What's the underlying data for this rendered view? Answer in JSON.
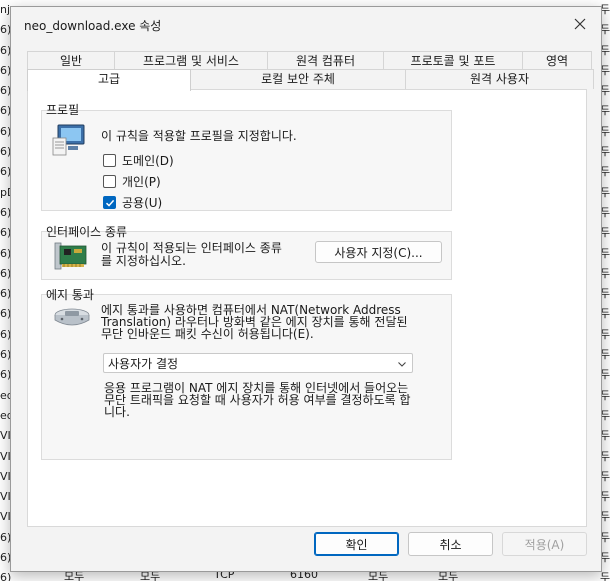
{
  "background": {
    "left_column": [
      "nj",
      "6)",
      "6)",
      "6)",
      "6)",
      "6)",
      "6)",
      "6)",
      "6)",
      "pD",
      "6)",
      "6)",
      "6)",
      "6)",
      "6)",
      "6)",
      "6)",
      "6)",
      "6)",
      "ed",
      "ed",
      "VID",
      "VID",
      "VID",
      "VID",
      "VID",
      "6)",
      "6)#C",
      "6)"
    ],
    "right_column": [
      "두",
      "두",
      "두",
      "두",
      "두",
      "두",
      "두",
      "두",
      "두",
      "두",
      "두",
      "두",
      "두",
      "두",
      "두",
      "두",
      "두",
      "두",
      "두",
      "두",
      "두",
      "두",
      "두",
      "두",
      "두",
      "두",
      "두",
      "두",
      "두"
    ],
    "bottom_row": [
      "모두",
      "모두",
      "TCP",
      "6160",
      "모두",
      "모두"
    ]
  },
  "dialog": {
    "title": "neo_download.exe 속성",
    "close_symbol": "✕"
  },
  "tabs": {
    "row1": [
      "일반",
      "프로그램 및 서비스",
      "원격 컴퓨터",
      "프로토콜 및 포트",
      "영역"
    ],
    "row2": [
      "고급",
      "로컬 보안 주체",
      "원격 사용자"
    ],
    "active": "고급"
  },
  "profiles": {
    "label": "프로필",
    "description": "이 규칙을 적용할 프로필을 지정합니다.",
    "options": [
      {
        "label": "도메인(D)",
        "checked": false
      },
      {
        "label": "개인(P)",
        "checked": false
      },
      {
        "label": "공용(U)",
        "checked": true
      }
    ]
  },
  "interface_types": {
    "label": "인터페이스 종류",
    "description_line1": "이 규칙이 적용되는 인터페이스 종류",
    "description_line2": "를 지정하십시오.",
    "customize_button": "사용자 지정(C)..."
  },
  "edge_traversal": {
    "label": "에지 통과",
    "description_line1": "에지 통과를 사용하면 컴퓨터에서 NAT(Network Address",
    "description_line2": "Translation) 라우터나 방화벽 같은 에지 장치를 통해 전달된",
    "description_line3": "무단 인바운드 패킷 수신이 허용됩니다(E).",
    "select_value": "사용자가 결정",
    "help_line1": "응용 프로그램이 NAT 에지 장치를 통해 인터넷에서 들어오는",
    "help_line2": "무단 트래픽을 요청할 때 사용자가 허용 여부를 결정하도록 합",
    "help_line3": "니다."
  },
  "footer": {
    "ok": "확인",
    "cancel": "취소",
    "apply": "적용(A)"
  },
  "colors": {
    "accent": "#0067c0",
    "dialog_bg": "#f3f3f3",
    "panel_bg": "#ffffff"
  }
}
